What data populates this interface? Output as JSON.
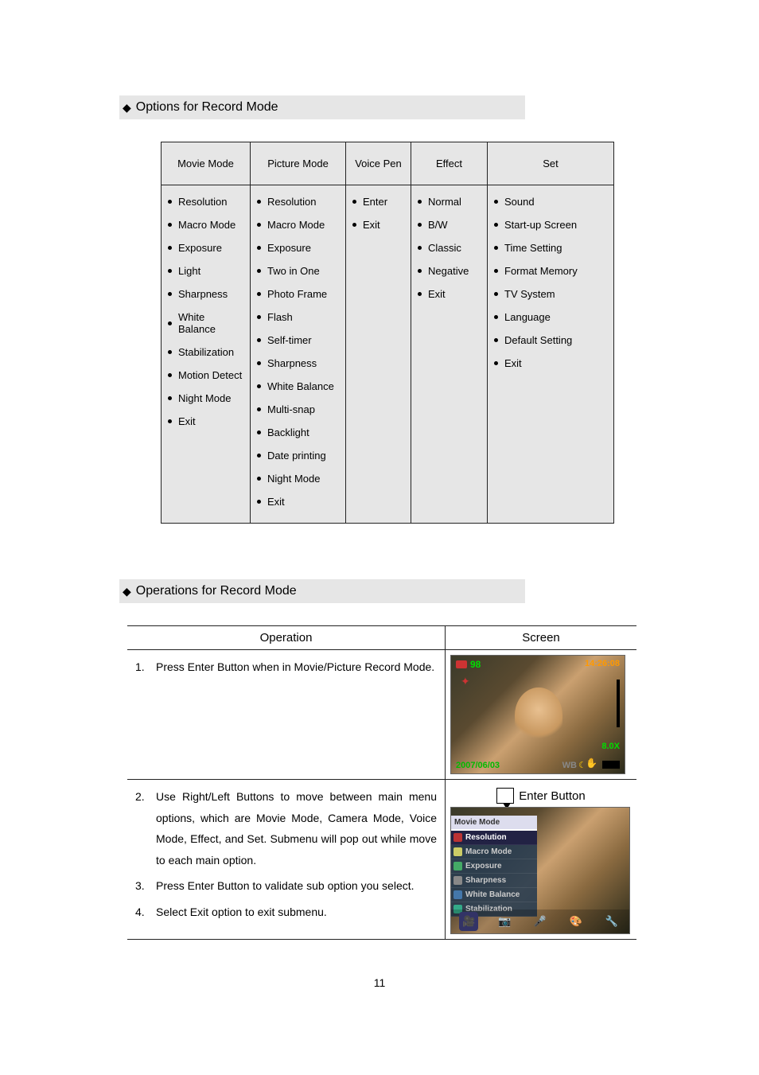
{
  "headings": {
    "options": "Options for Record Mode",
    "operations": "Operations for Record Mode"
  },
  "options_table": {
    "headers": [
      "Movie Mode",
      "Picture Mode",
      "Voice Pen",
      "Effect",
      "Set"
    ],
    "columns": [
      [
        "Resolution",
        "Macro Mode",
        "Exposure",
        "Light",
        "Sharpness",
        "White Balance",
        "Stabilization",
        "Motion Detect",
        "Night Mode",
        "Exit"
      ],
      [
        "Resolution",
        "Macro Mode",
        "Exposure",
        "Two in One",
        "Photo Frame",
        "Flash",
        "Self-timer",
        "Sharpness",
        "White Balance",
        "Multi-snap",
        "Backlight",
        "Date printing",
        "Night Mode",
        "Exit"
      ],
      [
        "Enter",
        "Exit"
      ],
      [
        "Normal",
        "B/W",
        "Classic",
        "Negative",
        "Exit"
      ],
      [
        "Sound",
        "Start-up Screen",
        "Time Setting",
        "Format Memory",
        "TV System",
        "Language",
        "Default Setting",
        "Exit"
      ]
    ]
  },
  "ops_table": {
    "headers": {
      "operation": "Operation",
      "screen": "Screen"
    },
    "row1": {
      "num": "1.",
      "text": "Press Enter Button when in Movie/Picture Record Mode."
    },
    "row2": {
      "items": [
        {
          "num": "2.",
          "text": "Use Right/Left Buttons to move between main menu options, which are Movie Mode, Camera Mode, Voice Mode, Effect, and Set. Submenu will pop out while move to each main option."
        },
        {
          "num": "3.",
          "text": "Press Enter Button to validate sub option you select."
        },
        {
          "num": "4.",
          "text": "Select Exit option to exit submenu."
        }
      ],
      "enter_button_label": "Enter Button"
    }
  },
  "screen1": {
    "count": "98",
    "time": "14:26:08",
    "date": "2007/06/03",
    "wb": "WB",
    "zoom": "8.0X"
  },
  "screen2_menu": {
    "title": "Movie Mode",
    "items": [
      "Resolution",
      "Macro Mode",
      "Exposure",
      "Sharpness",
      "White Balance",
      "Stabilization"
    ]
  },
  "page_number": "11"
}
